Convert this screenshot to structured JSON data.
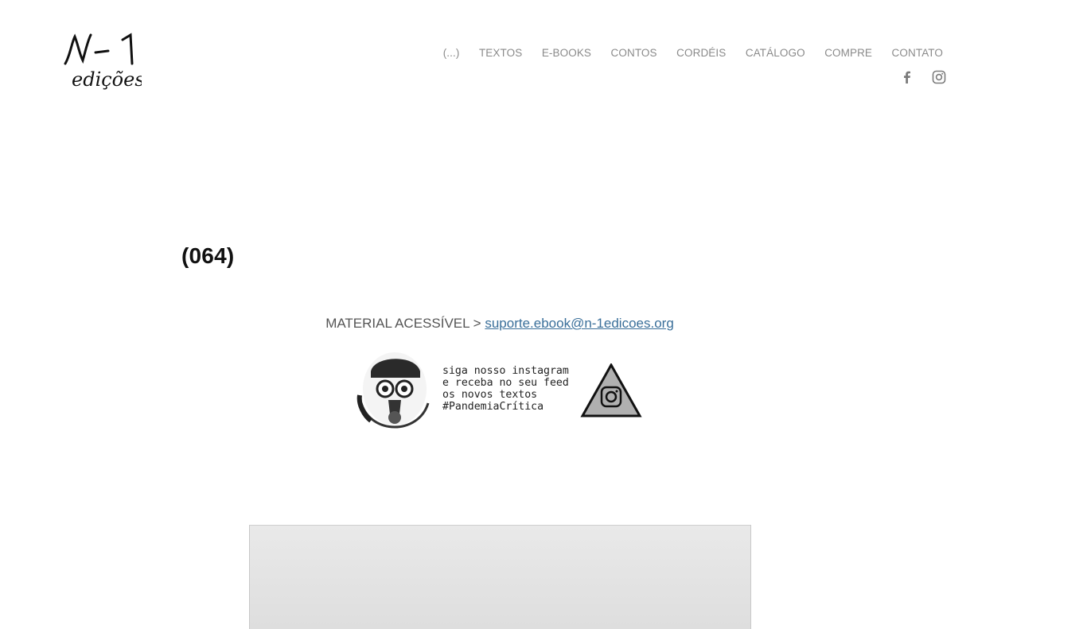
{
  "brand": {
    "logo_text_top": "N-1",
    "logo_text_bottom": "edições"
  },
  "nav": {
    "items": [
      "(...)",
      "TEXTOS",
      "E-BOOKS",
      "CONTOS",
      "CORDÉIS",
      "CATÁLOGO",
      "COMPRE",
      "CONTATO"
    ]
  },
  "social": {
    "facebook": "facebook-icon",
    "instagram": "instagram-icon"
  },
  "page": {
    "title": "(064)"
  },
  "accessible": {
    "label": "MATERIAL ACESSÍVEL > ",
    "email": "suporte.ebook@n-1edicoes.org"
  },
  "banner": {
    "line1": "siga nosso instagram",
    "line2": "e receba no seu feed",
    "line3": "os novos textos",
    "line4": "#PandemiaCrítica"
  }
}
